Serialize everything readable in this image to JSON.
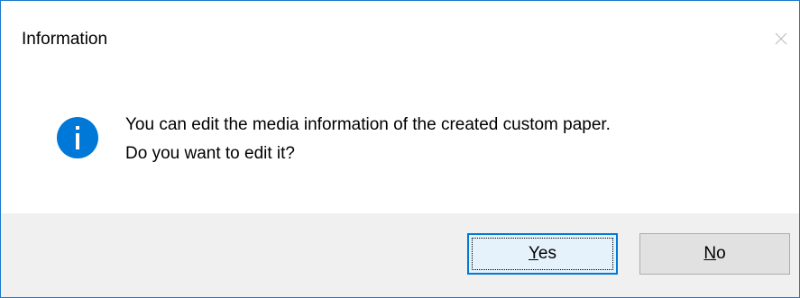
{
  "window": {
    "title": "Information",
    "close_icon": "close-icon"
  },
  "message": {
    "icon": "info-icon",
    "line1": "You can edit the media information of the created custom paper.",
    "line2": "Do you want to edit it?"
  },
  "buttons": {
    "yes": {
      "accel": "Y",
      "rest": "es",
      "default": true
    },
    "no": {
      "accel": "N",
      "rest": "o",
      "default": false
    }
  },
  "colors": {
    "accent": "#0078d7",
    "border": "#1979ca",
    "footer_bg": "#f0f0f0",
    "info_icon": "#0078d7"
  }
}
